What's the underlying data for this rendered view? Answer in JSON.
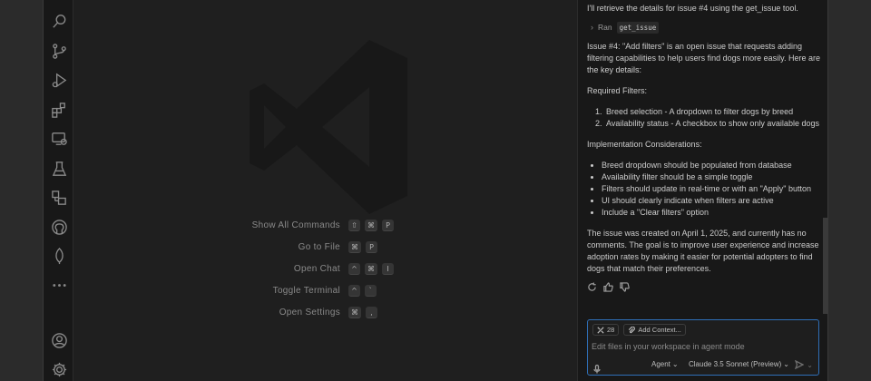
{
  "activity_bar": {
    "icons": [
      "search-icon",
      "source-control-icon",
      "run-debug-icon",
      "extensions-icon",
      "remote-explorer-icon",
      "testing-icon",
      "containers-icon",
      "github-icon",
      "mongodb-leaf-icon",
      "more-icon",
      "account-icon",
      "settings-gear-icon"
    ]
  },
  "shortcuts": [
    {
      "label": "Show All Commands",
      "keys": [
        "⇧",
        "⌘",
        "P"
      ]
    },
    {
      "label": "Go to File",
      "keys": [
        "⌘",
        "P"
      ]
    },
    {
      "label": "Open Chat",
      "keys": [
        "^",
        "⌘",
        "I"
      ]
    },
    {
      "label": "Toggle Terminal",
      "keys": [
        "^",
        "`"
      ]
    },
    {
      "label": "Open Settings",
      "keys": [
        "⌘",
        ","
      ]
    }
  ],
  "chat": {
    "intro": "I'll retrieve the details for issue #4 using the get_issue tool.",
    "ran_label": "Ran",
    "ran_tool": "get_issue",
    "summary": "Issue #4: \"Add filters\" is an open issue that requests adding filtering capabilities to help users find dogs more easily. Here are the key details:",
    "required_heading": "Required Filters:",
    "required_items": [
      "Breed selection - A dropdown to filter dogs by breed",
      "Availability status - A checkbox to show only available dogs"
    ],
    "impl_heading": "Implementation Considerations:",
    "impl_items": [
      "Breed dropdown should be populated from database",
      "Availability filter should be a simple toggle",
      "Filters should update in real-time or with an \"Apply\" button",
      "UI should clearly indicate when filters are active",
      "Include a \"Clear filters\" option"
    ],
    "closing": "The issue was created on April 1, 2025, and currently has no comments. The goal is to improve user experience and increase adoption rates by making it easier for potential adopters to find dogs that match their preferences."
  },
  "input": {
    "tools_count": "28",
    "add_context_label": "Add Context...",
    "placeholder": "Edit files in your workspace in agent mode",
    "mode": "Agent",
    "model": "Claude 3.5 Sonnet (Preview)"
  },
  "colors": {
    "accent": "#2f6fb7",
    "background": "#1f1f1f",
    "sidebar": "#181818"
  }
}
